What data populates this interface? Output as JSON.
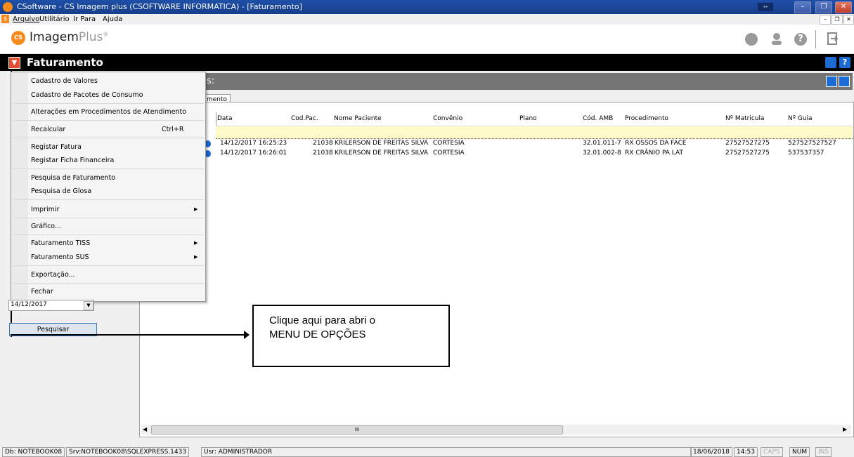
{
  "window": {
    "title": "CSoftware - CS Imagem plus (CSOFTWARE INFORMATICA) - [Faturamento]"
  },
  "menubar": {
    "items": [
      "Arquivo",
      "Utilitário",
      "Ir Para",
      "Ajuda"
    ]
  },
  "logo": {
    "brand1": "Imagem",
    "brand2": "Plus",
    "mark": "CS"
  },
  "module": {
    "title": "Faturamento"
  },
  "section": {
    "title": "os:"
  },
  "tab": {
    "label": "mento"
  },
  "grid": {
    "columns": [
      "Data",
      "Cod.Pac.",
      "Nome Paciente",
      "Convênio",
      "Plano",
      "Cód. AMB",
      "Procedimento",
      "Nº Matricula",
      "Nº Guia"
    ],
    "rows": [
      {
        "data": "14/12/2017 16:25:23",
        "codpac": "21038",
        "nome": "KRILERSON DE FREITAS SILVA",
        "convenio": "CORTESIA",
        "plano": "",
        "amb": "32.01.011-7",
        "proc": "RX OSSOS DA FACE",
        "matricula": "27527527275",
        "guia": "527527527527"
      },
      {
        "data": "14/12/2017 16:26:01",
        "codpac": "21038",
        "nome": "KRILERSON DE FREITAS SILVA",
        "convenio": "CORTESIA",
        "plano": "",
        "amb": "32.01.002-8",
        "proc": "RX CRÂNIO PA LAT",
        "matricula": "27527527275",
        "guia": "537537357"
      }
    ],
    "scroll_mark": "III"
  },
  "menu": {
    "items": {
      "cad_valores": "Cadastro de Valores",
      "cad_pacotes": "Cadastro de Pacotes de Consumo",
      "alteracoes": "Alterações em Procedimentos de Atendimento",
      "recalcular": "Recalcular",
      "recalcular_shortcut": "Ctrl+R",
      "registar_fatura": "Registar Fatura",
      "registar_ficha": "Registar Ficha Financeira",
      "pesq_fat": "Pesquisa de Faturamento",
      "pesq_glosa": "Pesquisa de Glosa",
      "imprimir": "Imprimir",
      "grafico": "Gráfico...",
      "fat_tiss": "Faturamento TISS",
      "fat_sus": "Faturamento SUS",
      "exportacao": "Exportação...",
      "fechar": "Fechar"
    }
  },
  "filter": {
    "date_value": "14/12/2017",
    "search_label": "Pesquisar"
  },
  "callout": {
    "line1": "Clique aqui para abri o",
    "line2": "MENU DE OPÇÕES"
  },
  "statusbar": {
    "db": "Db: NOTEBOOK08",
    "srv": "Srv:NOTEBOOK08\\SQLEXPRESS.1433",
    "usr": "Usr: ADMINISTRADOR",
    "date": "18/06/2018",
    "time": "14:53",
    "caps": "CAPS",
    "num": "NUM",
    "ins": "INS"
  },
  "colors": {
    "titlebar": "#1e4fa8",
    "module_bar": "#000000",
    "section_bar": "#757575",
    "highlight_row": "#fffbc8",
    "accent_blue": "#1e6bd6"
  }
}
